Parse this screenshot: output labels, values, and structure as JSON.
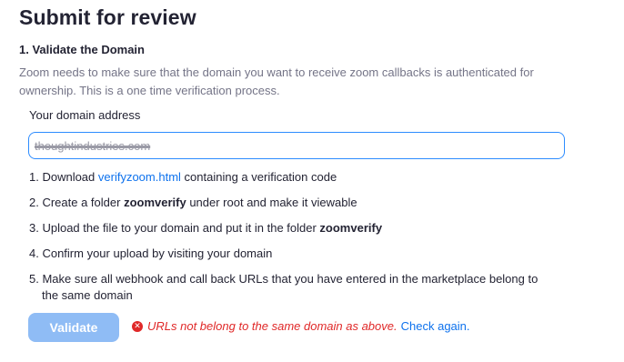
{
  "page": {
    "title": "Submit for review"
  },
  "section": {
    "title": "1. Validate the Domain",
    "description": "Zoom needs to make sure that the domain you want to receive zoom callbacks is authenticated for ownership. This is a one time verification process."
  },
  "domain_field": {
    "label": "Your domain address",
    "value": "thoughtindustries.com"
  },
  "steps": [
    {
      "prefix": "1. Download ",
      "link": "verifyzoom.html",
      "suffix": " containing a verification code"
    },
    {
      "prefix": "2. Create a folder ",
      "bold": "zoomverify",
      "suffix": " under root and make it viewable"
    },
    {
      "prefix": "3. Upload the file to your domain and put it in the folder ",
      "bold": "zoomverify",
      "suffix": ""
    },
    {
      "prefix": "4. Confirm your upload by visiting your domain",
      "suffix": ""
    },
    {
      "prefix": "5. Make sure all webhook and call back URLs that you have entered in the marketplace belong to",
      "line2": "the same domain"
    }
  ],
  "validate": {
    "button_label": "Validate",
    "error_icon": "error-circle-icon",
    "error_icon_glyph": "✕",
    "error_text": "URLs not belong to the same domain as above.",
    "check_again_label": "Check again."
  },
  "colors": {
    "accent": "#0e72ed",
    "input_border": "#2d8cff",
    "button_disabled": "#8fbcf5",
    "error": "#e02828",
    "muted_text": "#747487"
  }
}
